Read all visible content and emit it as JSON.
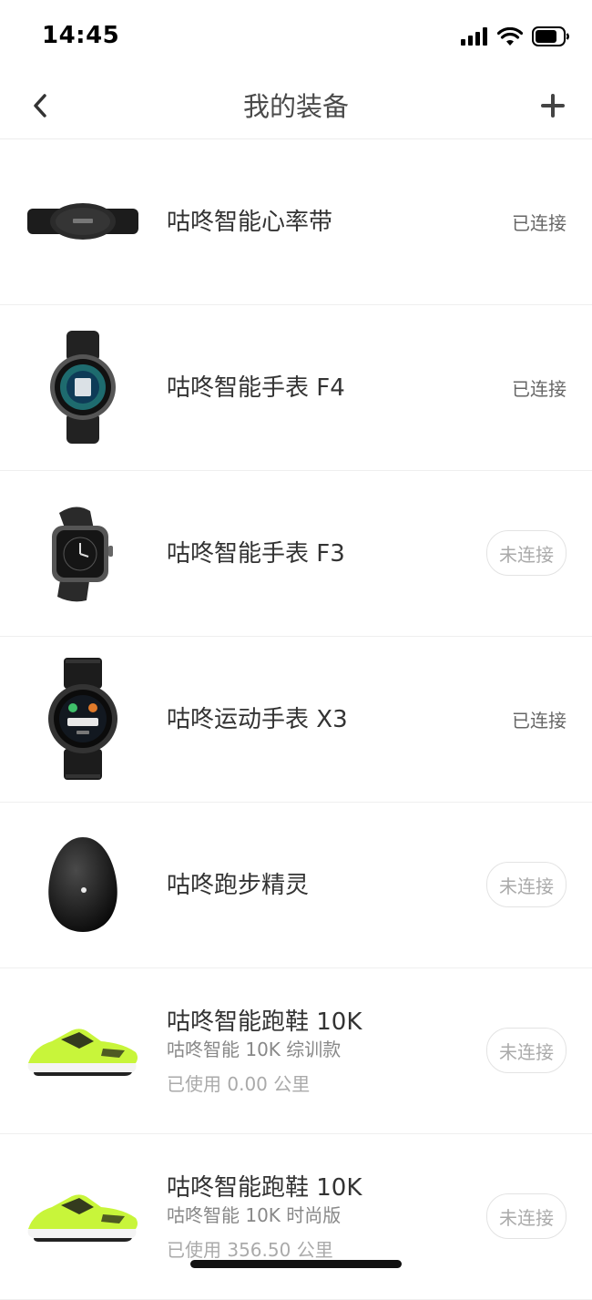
{
  "status_bar": {
    "time": "14:45",
    "icons": [
      "cellular-signal-icon",
      "wifi-icon",
      "battery-icon"
    ]
  },
  "header": {
    "title": "我的装备",
    "back_icon": "chevron-left-icon",
    "add_icon": "plus-icon"
  },
  "devices": [
    {
      "name": "咕咚智能心率带",
      "status": "已连接",
      "icon": "heart-rate-strap-icon"
    },
    {
      "name": "咕咚智能手表 F4",
      "status": "已连接",
      "icon": "round-smartwatch-icon"
    },
    {
      "name": "咕咚智能手表 F3",
      "status": "未连接",
      "icon": "square-smartwatch-icon"
    },
    {
      "name": "咕咚运动手表 X3",
      "status": "已连接",
      "icon": "sports-watch-icon"
    },
    {
      "name": "咕咚跑步精灵",
      "status": "未连接",
      "icon": "running-pod-icon"
    },
    {
      "name": "咕咚智能跑鞋 10K",
      "subtitle": "咕咚智能 10K 综训款",
      "usage": "已使用 0.00 公里",
      "status": "未连接",
      "icon": "running-shoe-icon"
    },
    {
      "name": "咕咚智能跑鞋 10K",
      "subtitle": "咕咚智能 10K 时尚版",
      "usage": "已使用 356.50 公里",
      "status": "未连接",
      "icon": "running-shoe-icon"
    }
  ],
  "colors": {
    "shoe_green": "#c8f53a",
    "text_primary": "#333333",
    "text_muted": "#aaaaaa"
  }
}
